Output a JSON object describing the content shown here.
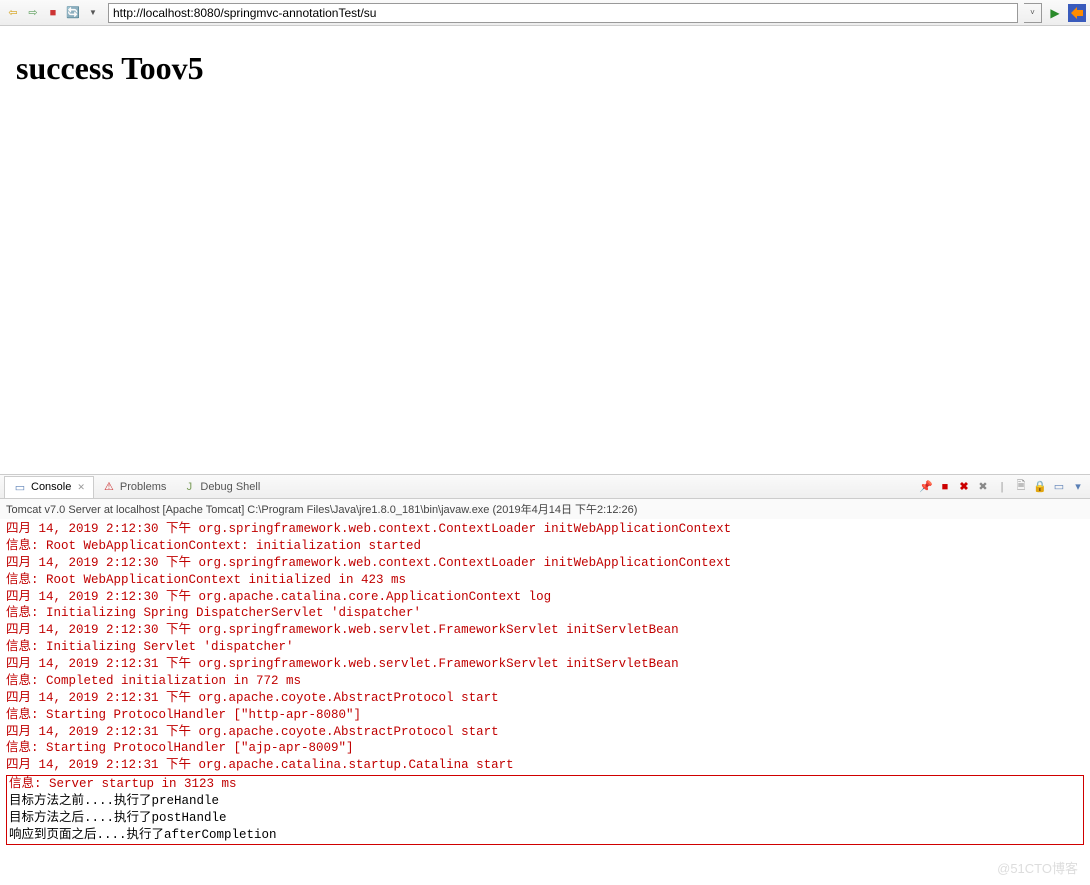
{
  "toolbar": {
    "url": "http://localhost:8080/springmvc-annotationTest/su"
  },
  "page": {
    "heading": "success Toov5"
  },
  "tabs": {
    "console": "Console",
    "problems": "Problems",
    "debugshell": "Debug Shell"
  },
  "console": {
    "header": "Tomcat v7.0 Server at localhost [Apache Tomcat] C:\\Program Files\\Java\\jre1.8.0_181\\bin\\javaw.exe (2019年4月14日 下午2:12:26)",
    "lines": [
      "四月 14, 2019 2:12:30 下午 org.springframework.web.context.ContextLoader initWebApplicationContext",
      "信息: Root WebApplicationContext: initialization started",
      "四月 14, 2019 2:12:30 下午 org.springframework.web.context.ContextLoader initWebApplicationContext",
      "信息: Root WebApplicationContext initialized in 423 ms",
      "四月 14, 2019 2:12:30 下午 org.apache.catalina.core.ApplicationContext log",
      "信息: Initializing Spring DispatcherServlet 'dispatcher'",
      "四月 14, 2019 2:12:30 下午 org.springframework.web.servlet.FrameworkServlet initServletBean",
      "信息: Initializing Servlet 'dispatcher'",
      "四月 14, 2019 2:12:31 下午 org.springframework.web.servlet.FrameworkServlet initServletBean",
      "信息: Completed initialization in 772 ms",
      "四月 14, 2019 2:12:31 下午 org.apache.coyote.AbstractProtocol start",
      "信息: Starting ProtocolHandler [\"http-apr-8080\"]",
      "四月 14, 2019 2:12:31 下午 org.apache.coyote.AbstractProtocol start",
      "信息: Starting ProtocolHandler [\"ajp-apr-8009\"]",
      "四月 14, 2019 2:12:31 下午 org.apache.catalina.startup.Catalina start"
    ],
    "boxed": [
      {
        "text": "信息: Server startup in 3123 ms",
        "red": true
      },
      {
        "text": "目标方法之前....执行了preHandle",
        "red": false
      },
      {
        "text": "目标方法之后....执行了postHandle",
        "red": false
      },
      {
        "text": "响应到页面之后....执行了afterCompletion",
        "red": false
      }
    ]
  },
  "watermark": "@51CTO博客"
}
